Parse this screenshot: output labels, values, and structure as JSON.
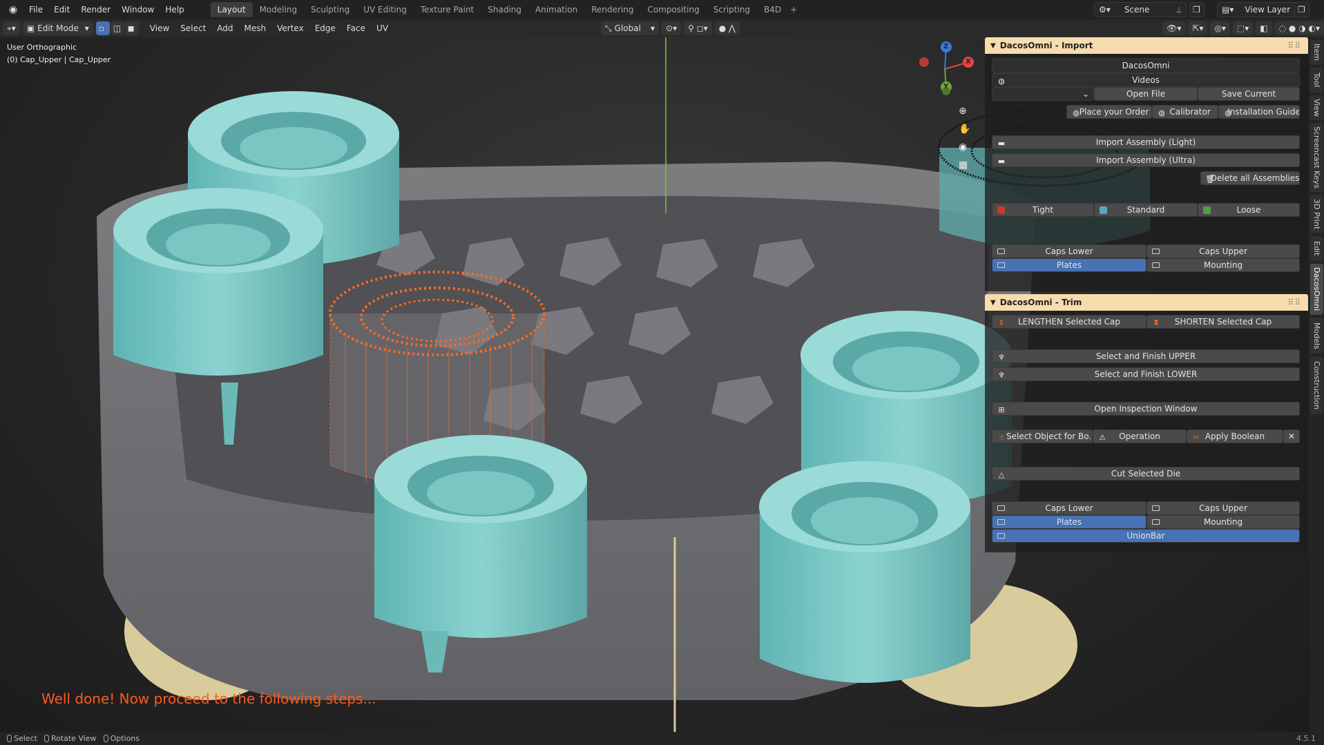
{
  "topbar": {
    "menus": [
      "File",
      "Edit",
      "Render",
      "Window",
      "Help"
    ],
    "workspaces": [
      "Layout",
      "Modeling",
      "Sculpting",
      "UV Editing",
      "Texture Paint",
      "Shading",
      "Animation",
      "Rendering",
      "Compositing",
      "Scripting",
      "B4D"
    ],
    "active_workspace": "Layout",
    "scene": "Scene",
    "view_layer": "View Layer"
  },
  "header": {
    "mode": "Edit Mode",
    "menus": [
      "View",
      "Select",
      "Add",
      "Mesh",
      "Vertex",
      "Edge",
      "Face",
      "UV"
    ],
    "transform_orientation": "Global"
  },
  "viewport": {
    "view_name": "User Orthographic",
    "object_info": "(0) Cap_Upper | Cap_Upper",
    "message": "Well done! Now proceed to the following steps...",
    "gizmo": {
      "x": "X",
      "y": "Y",
      "z": "Z",
      "x_color": "#e8433f",
      "y_color": "#6fa53a",
      "z_color": "#3a79e0"
    }
  },
  "import_panel": {
    "title": "DacosOmni - Import",
    "brand_button": "DacosOmni",
    "videos": "Videos",
    "open_file": "Open File",
    "save_current": "Save Current",
    "place_order": "Place your Order",
    "calibrator": "Calibrator",
    "installation_guide": "Installation Guide",
    "import_light": "Import Assembly (Light)",
    "import_ultra": "Import Assembly (Ultra)",
    "delete_all": "Delete all Assemblies",
    "fit": [
      {
        "label": "Tight",
        "color": "#c8382e"
      },
      {
        "label": "Standard",
        "color": "#5aa6c0"
      },
      {
        "label": "Loose",
        "color": "#4fa043"
      }
    ],
    "visibility": {
      "caps_lower": "Caps Lower",
      "caps_upper": "Caps Upper",
      "plates": "Plates",
      "mounting": "Mounting"
    }
  },
  "trim_panel": {
    "title": "DacosOmni - Trim",
    "lengthen": "LENGTHEN Selected Cap",
    "shorten": "SHORTEN Selected Cap",
    "finish_upper": "Select and Finish UPPER",
    "finish_lower": "Select and Finish LOWER",
    "inspection": "Open Inspection Window",
    "select_object": "Select Object for Bo...",
    "operation": "Operation",
    "apply_boolean": "Apply Boolean",
    "cut_die": "Cut Selected Die",
    "visibility": {
      "caps_lower": "Caps Lower",
      "caps_upper": "Caps Upper",
      "plates": "Plates",
      "mounting": "Mounting",
      "unionbar": "UnionBar"
    }
  },
  "sidetabs": [
    "Item",
    "Tool",
    "View",
    "Screencast Keys",
    "3D Print",
    "Edit",
    "DacosOmni",
    "Models",
    "Construction"
  ],
  "active_sidetab": "DacosOmni",
  "statusbar": {
    "select": "Select",
    "rotate": "Rotate View",
    "options": "Options",
    "version": "4.5.1"
  },
  "colors": {
    "accent_orange": "#ff5a1f",
    "cap_teal": "#74c6c4",
    "panel_header": "#f7dcae",
    "button_blue": "#4772b3"
  }
}
